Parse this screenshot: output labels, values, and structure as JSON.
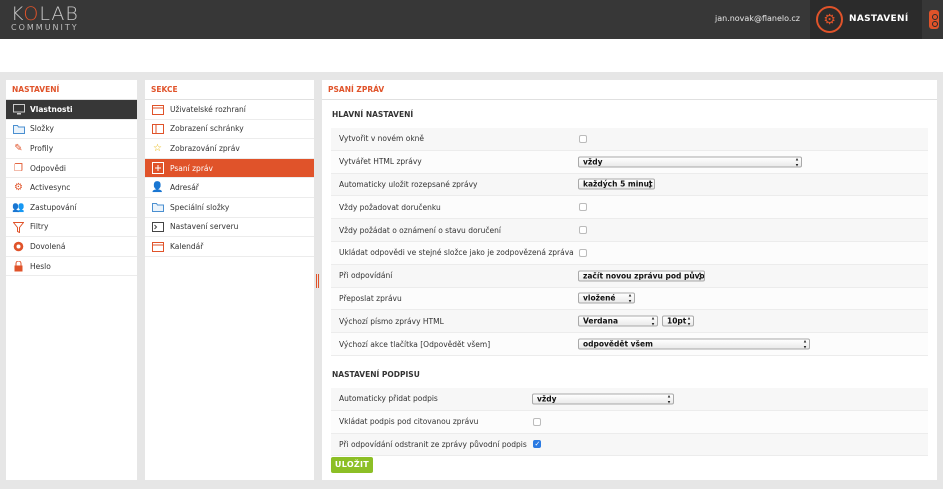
{
  "app": {
    "logo_main_prefix": "K",
    "logo_main_accent": "O",
    "logo_main_suffix": "LAB",
    "logo_sub": "COMMUNITY",
    "user_email": "jan.novak@flanelo.cz",
    "settings_label": "NASTAVENÍ"
  },
  "nastaveni": {
    "title": "NASTAVENÍ",
    "items": [
      {
        "label": "Vlastnosti",
        "icon": "monitor-icon"
      },
      {
        "label": "Složky",
        "icon": "folder-icon"
      },
      {
        "label": "Profily",
        "icon": "profile-icon"
      },
      {
        "label": "Odpovědi",
        "icon": "responses-icon"
      },
      {
        "label": "Activesync",
        "icon": "sync-gear-icon"
      },
      {
        "label": "Zastupování",
        "icon": "users-icon"
      },
      {
        "label": "Filtry",
        "icon": "filter-icon"
      },
      {
        "label": "Dovolená",
        "icon": "vacation-icon"
      },
      {
        "label": "Heslo",
        "icon": "lock-icon"
      }
    ]
  },
  "sekce": {
    "title": "SEKCE",
    "items": [
      {
        "label": "Uživatelské rozhraní"
      },
      {
        "label": "Zobrazení schránky"
      },
      {
        "label": "Zobrazování zpráv"
      },
      {
        "label": "Psaní zpráv"
      },
      {
        "label": "Adresář"
      },
      {
        "label": "Speciální složky"
      },
      {
        "label": "Nastavení serveru"
      },
      {
        "label": "Kalendář"
      }
    ]
  },
  "form": {
    "title": "PSANÍ ZPRÁV",
    "main_section": "HLAVNÍ NASTAVENÍ",
    "main_rows": [
      {
        "label": "Vytvořit v novém okně",
        "type": "checkbox",
        "checked": false
      },
      {
        "label": "Vytvářet HTML zprávy",
        "type": "select",
        "value": "vždy"
      },
      {
        "label": "Automaticky uložit rozepsané zprávy",
        "type": "select",
        "value": "každých 5 minut"
      },
      {
        "label": "Vždy požadovat doručenku",
        "type": "checkbox",
        "checked": false
      },
      {
        "label": "Vždy požádat o oznámení o stavu doručení",
        "type": "checkbox",
        "checked": false
      },
      {
        "label": "Ukládat odpovědi ve stejné složce jako je zodpovězená zpráva",
        "type": "checkbox",
        "checked": false
      },
      {
        "label": "Při odpovídání",
        "type": "select",
        "value": "začít novou zprávu pod původní"
      },
      {
        "label": "Přeposlat zprávu",
        "type": "select",
        "value": "vložené"
      },
      {
        "label": "Výchozí písmo zprávy HTML",
        "type": "select2",
        "value": "Verdana",
        "value2": "10pt"
      },
      {
        "label": "Výchozí akce tlačítka [Odpovědět všem]",
        "type": "select",
        "value": "odpovědět všem"
      }
    ],
    "sig_section": "NASTAVENÍ PODPISU",
    "sig_rows": [
      {
        "label": "Automaticky přidat podpis",
        "type": "select",
        "value": "vždy"
      },
      {
        "label": "Vkládat podpis pod citovanou zprávu",
        "type": "checkbox",
        "checked": false
      },
      {
        "label": "Při odpovídání odstranit ze zprávy původní podpis",
        "type": "checkbox",
        "checked": true
      }
    ],
    "save_label": "ULOŽIT"
  },
  "colors": {
    "accent": "#e0532a",
    "topbar": "#373737",
    "save": "#8cbf26"
  }
}
